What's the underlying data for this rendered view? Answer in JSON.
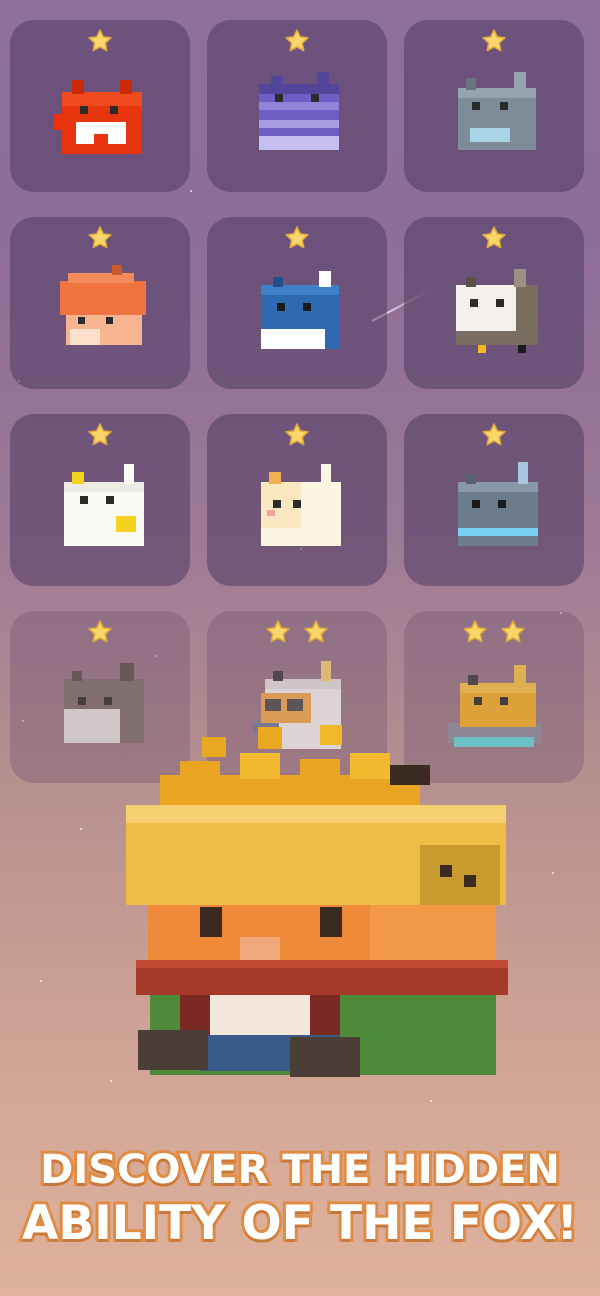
{
  "slogan": {
    "line1": "DISCOVER THE HIDDEN",
    "line2": "ABILITY OF THE FOX!"
  },
  "colors": {
    "star": "#f7d66a",
    "star_outline": "#e0a93c",
    "slogan_text": "#ffffff",
    "slogan_outline": "#e08c45"
  },
  "characters": [
    {
      "name": "red-fox",
      "stars": 1,
      "locked": false
    },
    {
      "name": "purple-fox",
      "stars": 1,
      "locked": false
    },
    {
      "name": "gray-cat",
      "stars": 1,
      "locked": false
    },
    {
      "name": "orange-mushroom-fox",
      "stars": 1,
      "locked": false
    },
    {
      "name": "blue-fox",
      "stars": 1,
      "locked": false
    },
    {
      "name": "white-fluffy-fox",
      "stars": 1,
      "locked": false
    },
    {
      "name": "white-yellow-fox",
      "stars": 1,
      "locked": false
    },
    {
      "name": "cream-fox",
      "stars": 1,
      "locked": false
    },
    {
      "name": "blue-gray-cat",
      "stars": 1,
      "locked": false
    },
    {
      "name": "gray-white-fox",
      "stars": 1,
      "locked": true
    },
    {
      "name": "glasses-fox",
      "stars": 2,
      "locked": true
    },
    {
      "name": "yellow-fox-on-cloud",
      "stars": 2,
      "locked": true
    }
  ],
  "featured": {
    "name": "king-fox",
    "icons": [
      "crown-icon"
    ]
  }
}
